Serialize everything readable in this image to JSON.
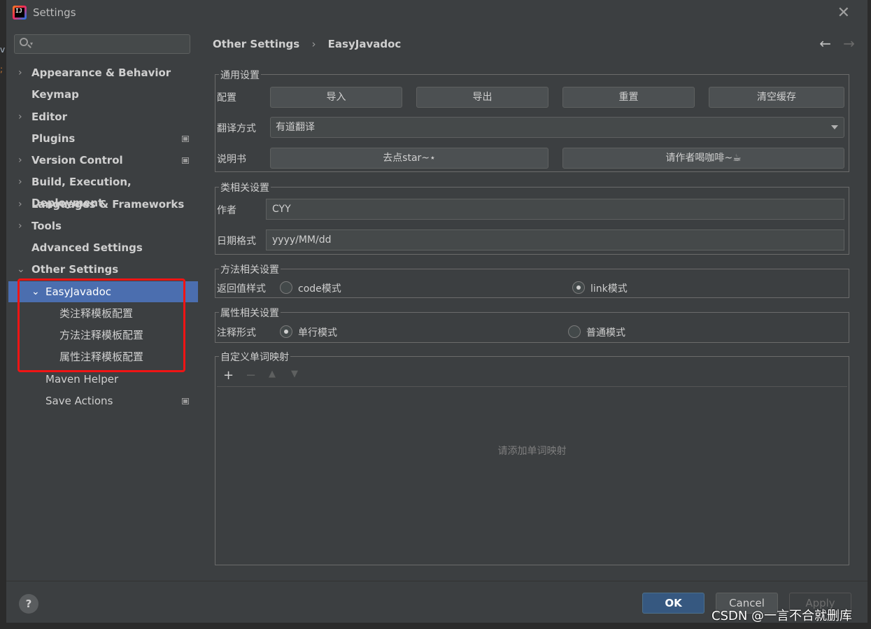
{
  "window": {
    "title": "Settings"
  },
  "sidebar": {
    "search_placeholder": "",
    "items": [
      {
        "label": "Appearance & Behavior"
      },
      {
        "label": "Keymap"
      },
      {
        "label": "Editor"
      },
      {
        "label": "Plugins"
      },
      {
        "label": "Version Control"
      },
      {
        "label": "Build, Execution, Deployment"
      },
      {
        "label": "Languages & Frameworks"
      },
      {
        "label": "Tools"
      },
      {
        "label": "Advanced Settings"
      },
      {
        "label": "Other Settings"
      },
      {
        "label": "EasyJavadoc"
      },
      {
        "label": "类注释模板配置"
      },
      {
        "label": "方法注释模板配置"
      },
      {
        "label": "属性注释模板配置"
      },
      {
        "label": "Maven Helper"
      },
      {
        "label": "Save Actions"
      }
    ]
  },
  "breadcrumb": {
    "parent": "Other Settings",
    "sep": "›",
    "current": "EasyJavadoc"
  },
  "general": {
    "title": "通用设置",
    "config_label": "配置",
    "import_btn": "导入",
    "export_btn": "导出",
    "reset_btn": "重置",
    "clear_cache_btn": "清空缓存",
    "translate_label": "翻译方式",
    "translate_value": "有道翻译",
    "manual_label": "说明书",
    "star_btn": "去点star~⋆",
    "coffee_btn": "请作者喝咖啡~☕"
  },
  "class_settings": {
    "title": "类相关设置",
    "author_label": "作者",
    "author_value": "CYY",
    "date_label": "日期格式",
    "date_value": "yyyy/MM/dd"
  },
  "method_settings": {
    "title": "方法相关设置",
    "return_label": "返回值样式",
    "option_code": "code模式",
    "option_link": "link模式",
    "selected": "link模式"
  },
  "field_settings": {
    "title": "属性相关设置",
    "comment_label": "注释形式",
    "option_single": "单行模式",
    "option_normal": "普通模式",
    "selected": "单行模式"
  },
  "word_mapping": {
    "title": "自定义单词映射",
    "empty_text": "请添加单词映射"
  },
  "footer": {
    "help": "?",
    "ok": "OK",
    "cancel": "Cancel",
    "apply": "Apply"
  },
  "watermark": "CSDN @一言不合就删库"
}
